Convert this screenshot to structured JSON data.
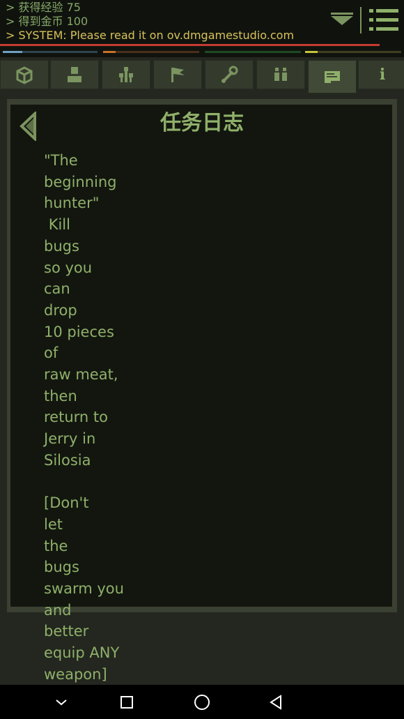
{
  "log": {
    "lines": [
      "> 获得经验 75",
      "> 得到金币 100",
      "> SYSTEM: Please read it on ov.dmgamestudio.com"
    ]
  },
  "icons": {
    "collapse": "chevron-down-double-icon",
    "menu": "hamburger-menu-icon",
    "back": "left-arrow-icon"
  },
  "status_bars": {
    "colors": [
      "#c53b32",
      "#6fa0c4",
      "#c8702a",
      "#3d8f3d",
      "#c4c43a"
    ]
  },
  "tabs": [
    {
      "name": "inventory",
      "icon": "box-icon"
    },
    {
      "name": "character",
      "icon": "person-icon"
    },
    {
      "name": "skills",
      "icon": "tree-icon"
    },
    {
      "name": "quests-map",
      "icon": "flag-icon"
    },
    {
      "name": "crafting",
      "icon": "wrench-icon"
    },
    {
      "name": "party",
      "icon": "people-icon"
    },
    {
      "name": "quest-log",
      "icon": "notepad-icon",
      "active": true
    },
    {
      "name": "info",
      "icon": "info-icon",
      "label": "i"
    }
  ],
  "panel": {
    "title": "任务日志",
    "quest_text": "\"The\nbeginning\nhunter\"\n Kill\nbugs\nso you\ncan\ndrop\n10 pieces\nof\nraw meat,\nthen\nreturn to\nJerry in\nSilosia\n\n[Don't\nlet\nthe\nbugs\nswarm you\nand\nbetter\nequip ANY\nweapon]"
  },
  "navbar": {
    "buttons": [
      "hide-keyboard-icon",
      "recents-icon",
      "home-icon",
      "back-icon"
    ]
  }
}
